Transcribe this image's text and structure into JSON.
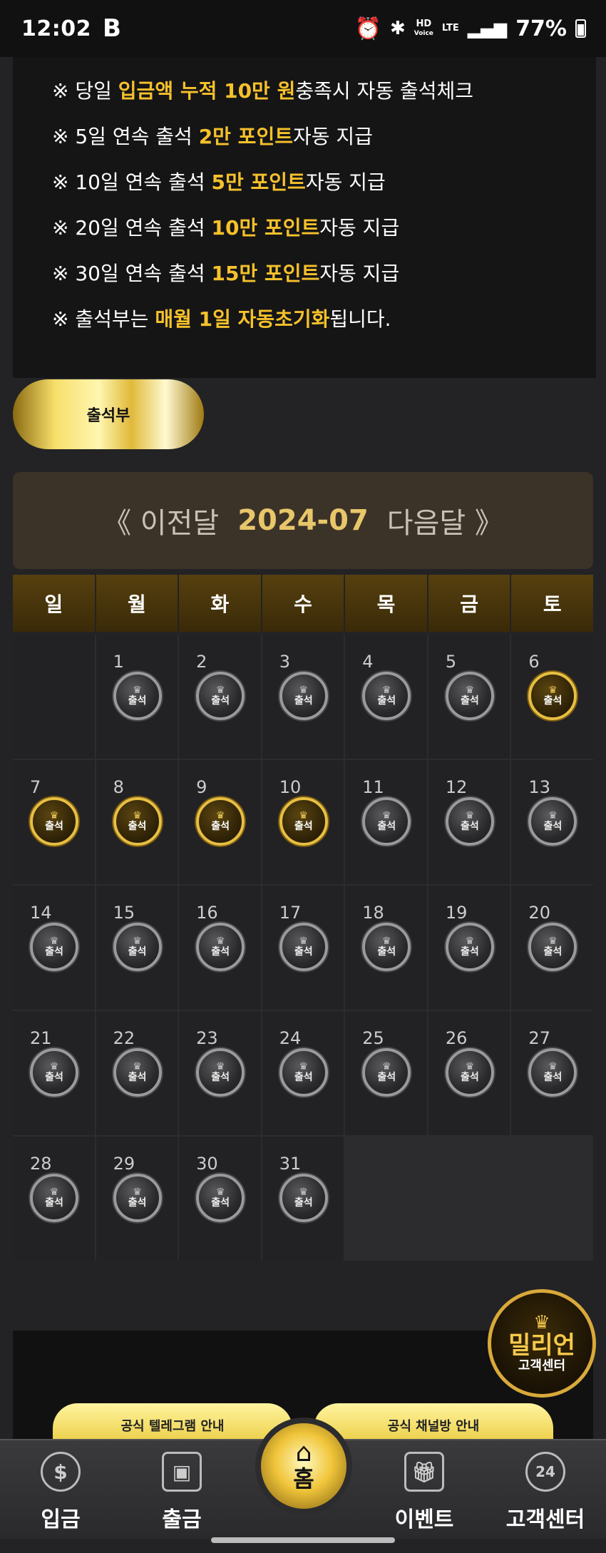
{
  "status_bar": {
    "time": "12:02",
    "app_badge": "B",
    "hd_label": "HD",
    "voice_label": "Voice",
    "lte_label": "LTE",
    "battery": "77%"
  },
  "notice": {
    "lines": [
      {
        "prefix": "※ 당일 ",
        "highlight": "입금액 누적 10만 원",
        "suffix": "충족시 자동 출석체크"
      },
      {
        "prefix": "※ 5일 연속 출석 ",
        "highlight": "2만 포인트",
        "suffix": "자동 지급"
      },
      {
        "prefix": "※ 10일 연속 출석 ",
        "highlight": "5만 포인트",
        "suffix": "자동 지급"
      },
      {
        "prefix": "※ 20일 연속 출석 ",
        "highlight": "10만 포인트",
        "suffix": "자동 지급"
      },
      {
        "prefix": "※ 30일 연속 출석 ",
        "highlight": "15만 포인트",
        "suffix": "자동 지급"
      },
      {
        "prefix": "※ 출석부는 ",
        "highlight": "매월 1일 자동초기화",
        "suffix": "됩니다."
      }
    ],
    "highlight_color": "#f6c12b"
  },
  "attendance_tab": "출석부",
  "month_nav": {
    "prev": "《 이전달",
    "current": "2024-07",
    "next": "다음달 》"
  },
  "weekdays": [
    "일",
    "월",
    "화",
    "수",
    "목",
    "금",
    "토"
  ],
  "calendar": {
    "stamp_label": "출석",
    "leading_blanks": 1,
    "days": [
      {
        "day": "1",
        "attended": false
      },
      {
        "day": "2",
        "attended": false
      },
      {
        "day": "3",
        "attended": false
      },
      {
        "day": "4",
        "attended": false
      },
      {
        "day": "5",
        "attended": false
      },
      {
        "day": "6",
        "attended": true
      },
      {
        "day": "7",
        "attended": true
      },
      {
        "day": "8",
        "attended": true
      },
      {
        "day": "9",
        "attended": true
      },
      {
        "day": "10",
        "attended": true
      },
      {
        "day": "11",
        "attended": false
      },
      {
        "day": "12",
        "attended": false
      },
      {
        "day": "13",
        "attended": false
      },
      {
        "day": "14",
        "attended": false
      },
      {
        "day": "15",
        "attended": false
      },
      {
        "day": "16",
        "attended": false
      },
      {
        "day": "17",
        "attended": false
      },
      {
        "day": "18",
        "attended": false
      },
      {
        "day": "19",
        "attended": false
      },
      {
        "day": "20",
        "attended": false
      },
      {
        "day": "21",
        "attended": false
      },
      {
        "day": "22",
        "attended": false
      },
      {
        "day": "23",
        "attended": false
      },
      {
        "day": "24",
        "attended": false
      },
      {
        "day": "25",
        "attended": false
      },
      {
        "day": "26",
        "attended": false
      },
      {
        "day": "27",
        "attended": false
      },
      {
        "day": "28",
        "attended": false
      },
      {
        "day": "29",
        "attended": false
      },
      {
        "day": "30",
        "attended": false
      },
      {
        "day": "31",
        "attended": false
      }
    ]
  },
  "customer_badge": {
    "title": "밀리언",
    "subtitle": "고객센터"
  },
  "channel_buttons": {
    "telegram": "공식 텔레그램 안내",
    "channel": "공식 채널방 안내"
  },
  "bottom_nav": {
    "deposit": {
      "label": "입금",
      "icon": "dollar-icon"
    },
    "withdraw": {
      "label": "출금",
      "icon": "wallet-icon"
    },
    "home": {
      "label": "홈",
      "icon": "home-icon"
    },
    "event": {
      "label": "이벤트",
      "icon": "gift-icon"
    },
    "support": {
      "label": "고객센터",
      "icon": "24h-icon"
    }
  }
}
